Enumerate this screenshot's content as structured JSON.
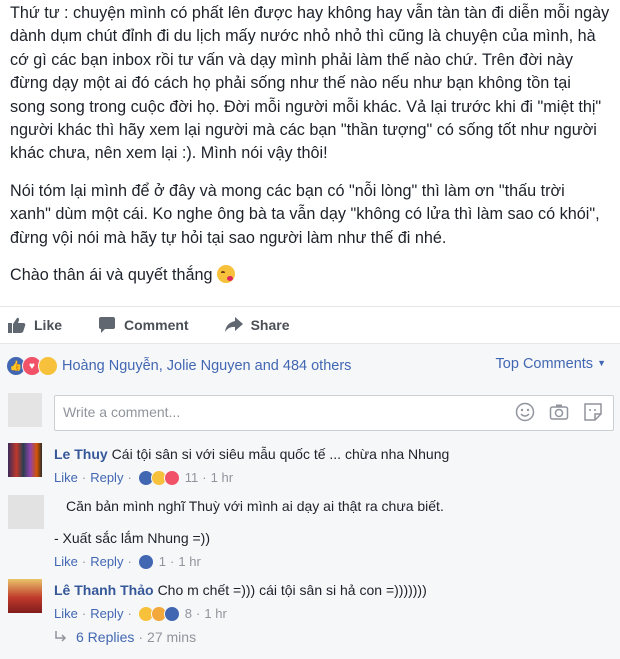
{
  "post": {
    "paragraphs": [
      "Thứ tư : chuyện mình có phất lên được hay không hay vẫn tàn tàn đi diễn mỗi ngày dành dụm chút đỉnh đi du lịch mấy nước nhỏ nhỏ thì cũng là chuyện của mình, hà cớ gì các bạn inbox rồi tư vấn và dạy mình phải làm thế nào chứ. Trên đời này đừng dạy một ai đó cách họ phải sống như thế nào nếu như bạn không tồn tại song song trong cuộc đời họ. Đời mỗi người mỗi khác. Vả lại trước khi đi \"miệt thị\" người khác thì hãy xem lại người mà các bạn \"thần tượng\" có sống tốt như người khác chưa, nên xem lại :). Mình nói vậy thôi!",
      "Nói tóm lại mình để ở đây và mong các bạn có \"nỗi lòng\" thì làm ơn \"thấu trời xanh\" dùm một cái. Ko nghe ông bà ta vẫn dạy \"không có lửa thì làm sao có khói\", đừng vội nói mà hãy tự hỏi tại sao người làm như thế đi nhé.",
      "Chào thân ái và quyết thắng"
    ]
  },
  "actions": {
    "like": "Like",
    "comment": "Comment",
    "share": "Share"
  },
  "reactions": {
    "names": "Hoàng Nguyễn, Jolie Nguyen",
    "and_others": "and 484 others",
    "sort_label": "Top Comments"
  },
  "composer": {
    "placeholder": "Write a comment..."
  },
  "comments": [
    {
      "name": "Le Thuy",
      "text": "Cái tội sân si với siêu mẫu quốc tế ... chừa nha Nhung",
      "like": "Like",
      "reply": "Reply",
      "count": "11",
      "time": "1 hr"
    },
    {
      "name": "",
      "text": "Căn bản mình nghĩ Thuỳ với mình ai dạy ai thật ra chưa biết.",
      "text2": "- Xuất sắc lắm Nhung =))",
      "like": "Like",
      "reply": "Reply",
      "count": "1",
      "time": "1 hr"
    },
    {
      "name": "Lê Thanh Thảo",
      "text": "Cho m chết =))) cái tội sân si hả con =)))))))",
      "like": "Like",
      "reply": "Reply",
      "count": "8",
      "time": "1 hr"
    }
  ],
  "replies": {
    "label": "6 Replies",
    "time": "27 mins"
  },
  "colors": {
    "link": "#4267b2",
    "name": "#365899",
    "bar_bg": "#f6f7f9"
  }
}
